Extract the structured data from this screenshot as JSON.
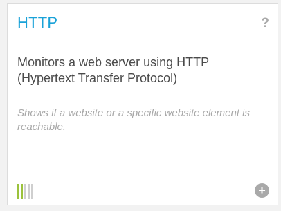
{
  "sensor": {
    "title": "HTTP",
    "help_icon": "?",
    "description": "Monitors a web server using HTTP (Hypertext Transfer Protocol)",
    "note": "Shows if a website or a specific website element is reachable.",
    "impact_level": 2,
    "impact_max": 5,
    "add_icon": "+",
    "colors": {
      "title": "#1aa2d8",
      "active_bar": "#9bc23c",
      "inactive_bar": "#cfcfcf",
      "icon": "#a9a9a9"
    }
  }
}
